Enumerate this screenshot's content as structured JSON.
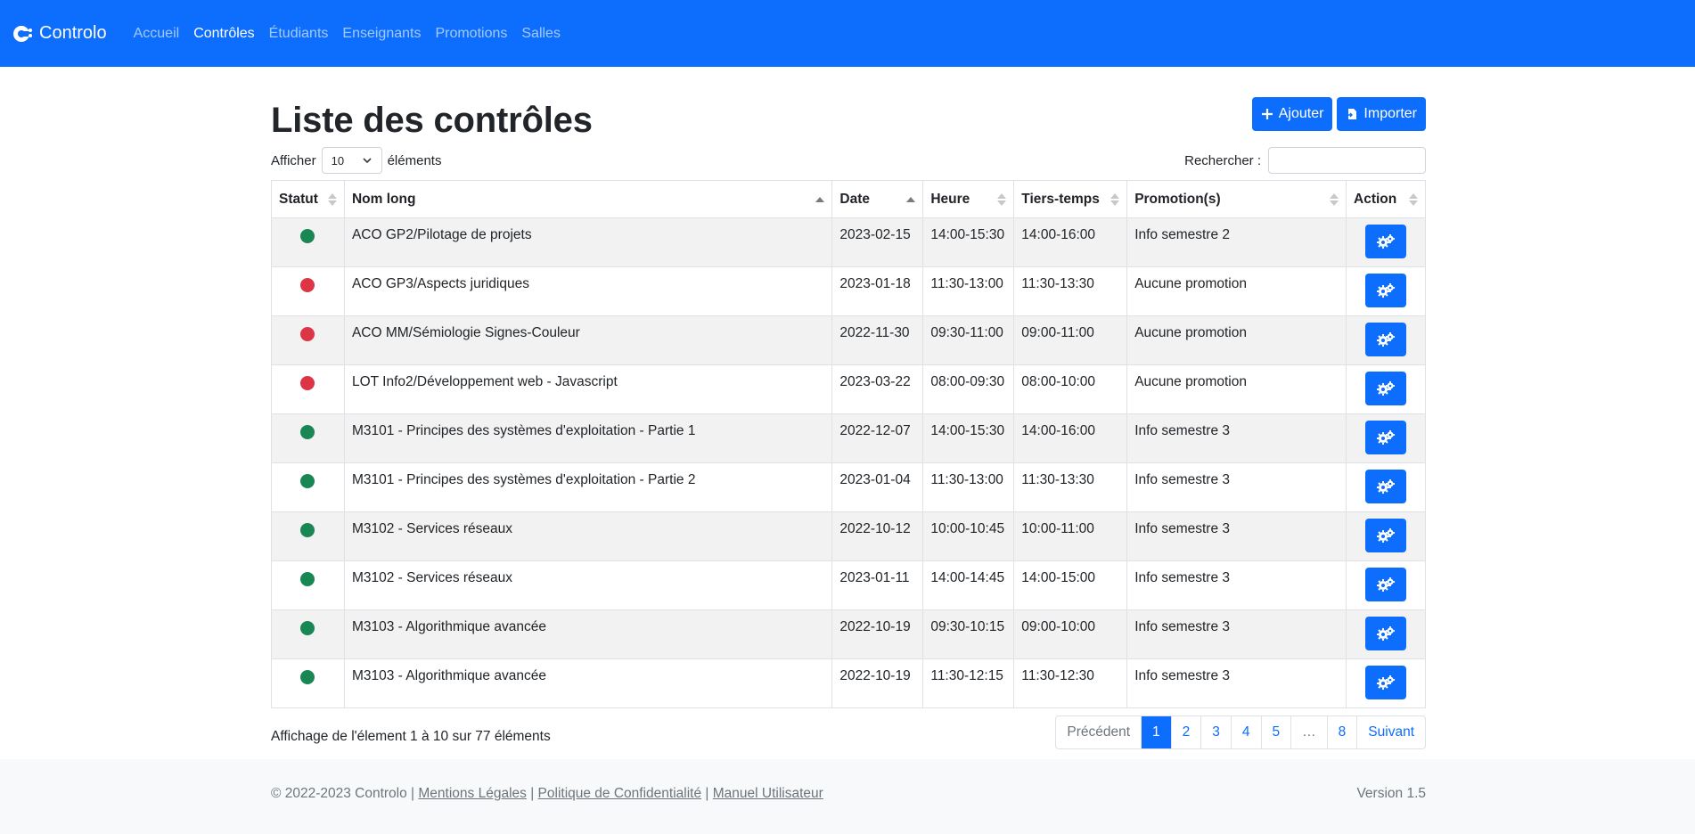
{
  "navbar": {
    "brand": "Controlo",
    "links": [
      {
        "label": "Accueil",
        "active": false
      },
      {
        "label": "Contrôles",
        "active": true
      },
      {
        "label": "Étudiants",
        "active": false
      },
      {
        "label": "Enseignants",
        "active": false
      },
      {
        "label": "Promotions",
        "active": false
      },
      {
        "label": "Salles",
        "active": false
      }
    ]
  },
  "page": {
    "title": "Liste des contrôles",
    "add_label": "Ajouter",
    "import_label": "Importer"
  },
  "controls": {
    "show_label": "Afficher",
    "page_size": "10",
    "elements_label": "éléments",
    "search_label": "Rechercher :",
    "search_value": ""
  },
  "table": {
    "columns": [
      "Statut",
      "Nom long",
      "Date",
      "Heure",
      "Tiers-temps",
      "Promotion(s)",
      "Action"
    ],
    "rows": [
      {
        "status": "green",
        "name": "ACO GP2/Pilotage de projets",
        "date": "2023-02-15",
        "time": "14:00-15:30",
        "extra": "14:00-16:00",
        "promo": "Info semestre 2"
      },
      {
        "status": "red",
        "name": "ACO GP3/Aspects juridiques",
        "date": "2023-01-18",
        "time": "11:30-13:00",
        "extra": "11:30-13:30",
        "promo": "Aucune promotion"
      },
      {
        "status": "red",
        "name": "ACO MM/Sémiologie Signes-Couleur",
        "date": "2022-11-30",
        "time": "09:30-11:00",
        "extra": "09:00-11:00",
        "promo": "Aucune promotion"
      },
      {
        "status": "red",
        "name": "LOT Info2/Développement web - Javascript",
        "date": "2023-03-22",
        "time": "08:00-09:30",
        "extra": "08:00-10:00",
        "promo": "Aucune promotion"
      },
      {
        "status": "green",
        "name": "M3101 - Principes des systèmes d'exploitation - Partie 1",
        "date": "2022-12-07",
        "time": "14:00-15:30",
        "extra": "14:00-16:00",
        "promo": "Info semestre 3"
      },
      {
        "status": "green",
        "name": "M3101 - Principes des systèmes d'exploitation - Partie 2",
        "date": "2023-01-04",
        "time": "11:30-13:00",
        "extra": "11:30-13:30",
        "promo": "Info semestre 3"
      },
      {
        "status": "green",
        "name": "M3102 - Services réseaux",
        "date": "2022-10-12",
        "time": "10:00-10:45",
        "extra": "10:00-11:00",
        "promo": "Info semestre 3"
      },
      {
        "status": "green",
        "name": "M3102 - Services réseaux",
        "date": "2023-01-11",
        "time": "14:00-14:45",
        "extra": "14:00-15:00",
        "promo": "Info semestre 3"
      },
      {
        "status": "green",
        "name": "M3103 - Algorithmique avancée",
        "date": "2022-10-19",
        "time": "09:30-10:15",
        "extra": "09:00-10:00",
        "promo": "Info semestre 3"
      },
      {
        "status": "green",
        "name": "M3103 - Algorithmique avancée",
        "date": "2022-10-19",
        "time": "11:30-12:15",
        "extra": "11:30-12:30",
        "promo": "Info semestre 3"
      }
    ]
  },
  "pagination": {
    "info": "Affichage de l'élement 1 à 10 sur 77 éléments",
    "prev": "Précédent",
    "pages": [
      "1",
      "2",
      "3",
      "4",
      "5",
      "…",
      "8"
    ],
    "next": "Suivant",
    "current": "1"
  },
  "footer": {
    "copyright": "© 2022-2023 Controlo |",
    "mentions": "Mentions Légales",
    "sep1": "|",
    "privacy": "Politique de Confidentialité",
    "sep2": "|",
    "manual": "Manuel Utilisateur",
    "version": "Version 1.5"
  },
  "colors": {
    "primary": "#0d6efd",
    "status_green": "#198754",
    "status_red": "#dc3545"
  },
  "icons": {
    "brand": "controlo-logo-icon",
    "add": "plus-icon",
    "import": "file-import-icon",
    "select": "chevron-down-icon",
    "action": "gears-icon"
  }
}
